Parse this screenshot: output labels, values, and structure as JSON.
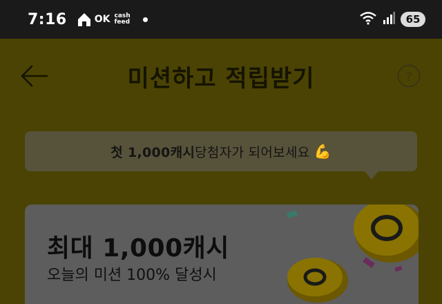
{
  "status_bar": {
    "time": "7:16",
    "ok_label": "OK",
    "cashfeed_line1": "cash",
    "cashfeed_line2": "feed",
    "battery": "65"
  },
  "header": {
    "title": "미션하고 적립받기"
  },
  "banner": {
    "highlight": "첫 1,000캐시",
    "text": " 당첨자가 되어보세요",
    "emoji": "💪"
  },
  "reward_card": {
    "title": "최대 1,000캐시",
    "subtitle": "오늘의 미션 100% 달성시"
  },
  "colors": {
    "overlay_yellow": "#4a4303",
    "status_bar_bg": "#1a1a1a",
    "card_bg": "#5d5d5d",
    "coin": "#8a7300"
  },
  "icons": [
    "home-icon",
    "wifi-icon",
    "signal-icon",
    "back-arrow-icon",
    "help-icon",
    "coin-icon",
    "flexed-biceps-icon"
  ]
}
